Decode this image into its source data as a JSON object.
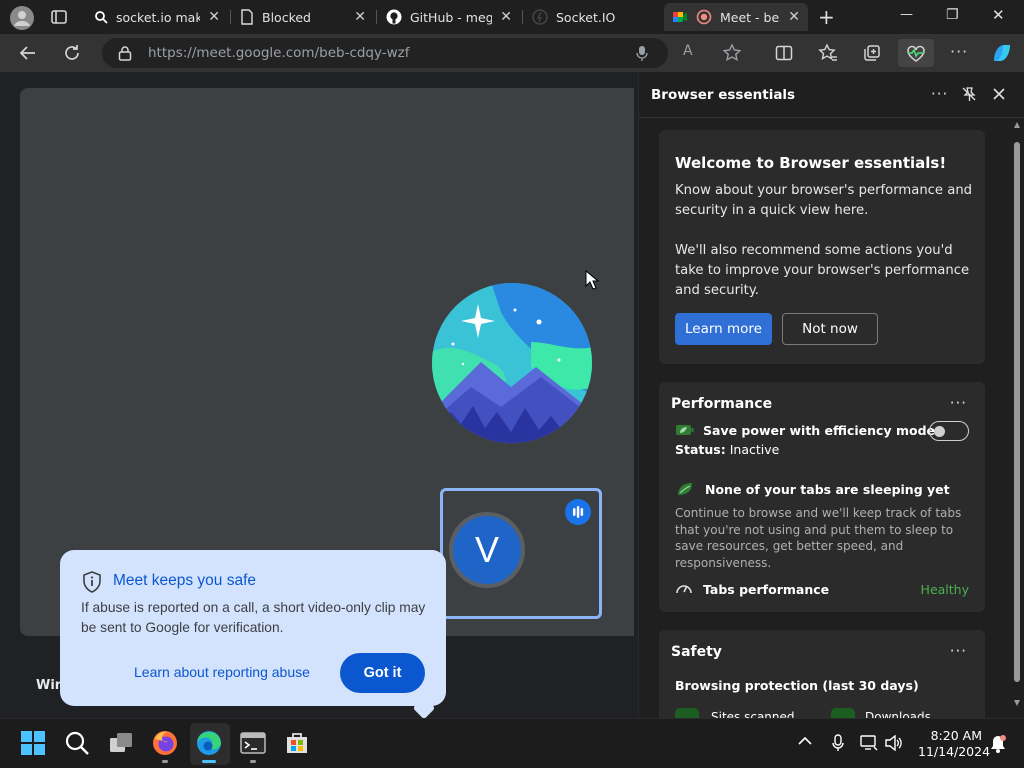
{
  "tabs": [
    {
      "title": "socket.io makes",
      "icon": "search-icon",
      "close": "✕"
    },
    {
      "title": "Blocked",
      "icon": "page-icon",
      "close": "✕"
    },
    {
      "title": "GitHub - megal",
      "icon": "github-icon",
      "close": "✕"
    },
    {
      "title": "Socket.IO",
      "icon": "socketio-icon",
      "close": ""
    },
    {
      "title": "Meet - bel",
      "icon": "meet-icon",
      "close": "✕"
    }
  ],
  "window_controls": {
    "new_tab": "+",
    "minimize": "—",
    "restore": "❐",
    "close": "✕"
  },
  "address_bar": {
    "url": "https://meet.google.com/beb-cdqy-wzf",
    "read_aloud": "A"
  },
  "meet": {
    "self_initial": "V",
    "participant_label": "Win",
    "popup": {
      "title": "Meet keeps you safe",
      "body": "If abuse is reported on a call, a short video-only clip may be sent to Google for verification.",
      "link": "Learn about reporting abuse",
      "button": "Got it"
    }
  },
  "sidebar": {
    "title": "Browser essentials",
    "welcome": {
      "title": "Welcome to Browser essentials!",
      "text1": "Know about your browser's performance and security in a quick view here.",
      "text2": "We'll also recommend some actions you'd take to improve your browser's performance and security.",
      "learn_more": "Learn more",
      "not_now": "Not now"
    },
    "performance": {
      "title": "Performance",
      "efficiency_label": "Save power with efficiency mode",
      "status_label": "Status:",
      "status_value": "Inactive",
      "efficiency_on": false,
      "sleeping_title": "None of your tabs are sleeping yet",
      "sleeping_text": "Continue to browse and we'll keep track of tabs that you're not using and put them to sleep to save resources, get better speed, and responsiveness.",
      "tabs_perf_label": "Tabs performance",
      "tabs_perf_value": "Healthy"
    },
    "safety": {
      "title": "Safety",
      "browsing_label": "Browsing protection (last 30 days)",
      "sites_scanned": "Sites scanned",
      "downloads_scanned": "Downloads scanned"
    }
  },
  "taskbar": {
    "time": "8:20 AM",
    "date": "11/14/2024"
  },
  "colors": {
    "accent": "#2f6fd6",
    "healthy": "#4caf50",
    "meet_blue": "#0b57d0",
    "popup_bg": "#d3e3fd"
  }
}
